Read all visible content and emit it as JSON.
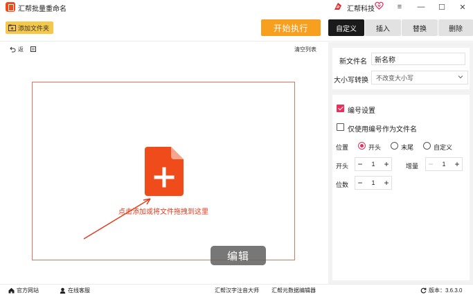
{
  "titlebar": {
    "app_title": "汇帮批量重命名",
    "brand_name": "汇帮科技",
    "menu_symbol": "≡",
    "minimize_symbol": "—",
    "maximize_symbol": "☐",
    "close_symbol": "✕"
  },
  "toolbar": {
    "add_folder_label": "添加文件夹",
    "start_label": "开始执行",
    "tabs": [
      {
        "label": "自定义",
        "active": true
      },
      {
        "label": "插入",
        "active": false
      },
      {
        "label": "替换",
        "active": false
      },
      {
        "label": "删除",
        "active": false
      }
    ]
  },
  "file_list": {
    "undo_label": "返",
    "clear_label": "清空列表",
    "drop_hint": "点击添加或将文件拖拽到这里",
    "edit_badge": "编辑"
  },
  "settings": {
    "new_name_label": "新文件名",
    "new_name_value": "新名称",
    "case_label": "大小写转换",
    "case_value": "不改变大小写",
    "numbering_label": "编号设置",
    "numbering_checked": true,
    "only_number_label": "仅使用编号作为文件名",
    "only_number_checked": false,
    "position_label": "位置",
    "position_options": [
      {
        "label": "开头",
        "checked": true
      },
      {
        "label": "末尾",
        "checked": false
      },
      {
        "label": "自定义",
        "checked": false
      }
    ],
    "start_label": "开头",
    "start_value": "1",
    "increment_label": "增量",
    "increment_value": "1",
    "digits_label": "位数",
    "digits_value": "1"
  },
  "statusbar": {
    "website_label": "官方网站",
    "support_label": "在线客服",
    "pinyin_tool": "汇帮汉字注音大师",
    "metadata_tool": "汇帮元数据编辑器",
    "version_label": "版本：",
    "version_value": "3.6.3.0"
  },
  "colors": {
    "accent_orange": "#f7a020",
    "folder_button": "#f6c84a",
    "active_tab": "#1a1a1a",
    "checkbox_pink": "#e8305a",
    "file_icon_red": "#f04b1a",
    "drop_border": "#e0745a"
  },
  "icons": {
    "app": "rename-app-icon",
    "brand": "huibang-logo-icon",
    "vip": "heart-vip-icon",
    "folder": "add-folder-icon",
    "undo": "undo-icon",
    "file_add": "file-add-icon",
    "home": "home-icon",
    "support": "headset-icon",
    "refresh": "refresh-icon"
  }
}
